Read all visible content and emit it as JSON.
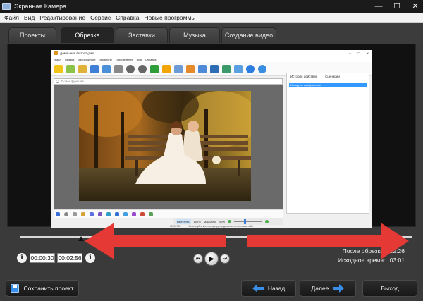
{
  "window": {
    "title": "Экранная Камера",
    "minimize": "—",
    "maximize": "☐",
    "close": "✕"
  },
  "menu": [
    "Файл",
    "Вид",
    "Редактирование",
    "Сервис",
    "Справка",
    "Новые программы"
  ],
  "tabs": [
    "Проекты",
    "Обрезка",
    "Заставки",
    "Музыка",
    "Создание видео"
  ],
  "active_tab": "Обрезка",
  "inner_app": {
    "title": "Домашняя Фотостудия",
    "menu": [
      "Файл",
      "Правка",
      "Изображение",
      "Эффекты",
      "Оформление",
      "Вид",
      "Справка"
    ],
    "search_placeholder": "Поиск функций...",
    "side_tabs": [
      "История действий",
      "Сценарии"
    ],
    "side_item": "Исходное изображение",
    "zoom_fit": "Вместить",
    "zoom_100": "100%",
    "zoom_label": "Масштаб:",
    "zoom_value": "99%",
    "status_size": "1200x733",
    "status_hint": "Используйте колесо прокрутки для изменения масштаба"
  },
  "trim": {
    "start_time": "00:00:30",
    "end_time": "00:02:56",
    "after_trim_label": "После обрезки:",
    "after_trim_value": "02:26",
    "original_label": "Исходное время:",
    "original_value": "03:01",
    "start_fraction": 0.17,
    "end_fraction": 0.97
  },
  "info_glyph": "i",
  "playback": {
    "prev": "⏮",
    "play": "▶",
    "next": "⏭"
  },
  "footer": {
    "save": "Сохранить проект",
    "back": "Назад",
    "next": "Далее",
    "exit": "Выход"
  },
  "colors": {
    "accent_arrow": "#e53935",
    "nav_arrow": "#3a8ee6",
    "selection": "#3399ff"
  }
}
